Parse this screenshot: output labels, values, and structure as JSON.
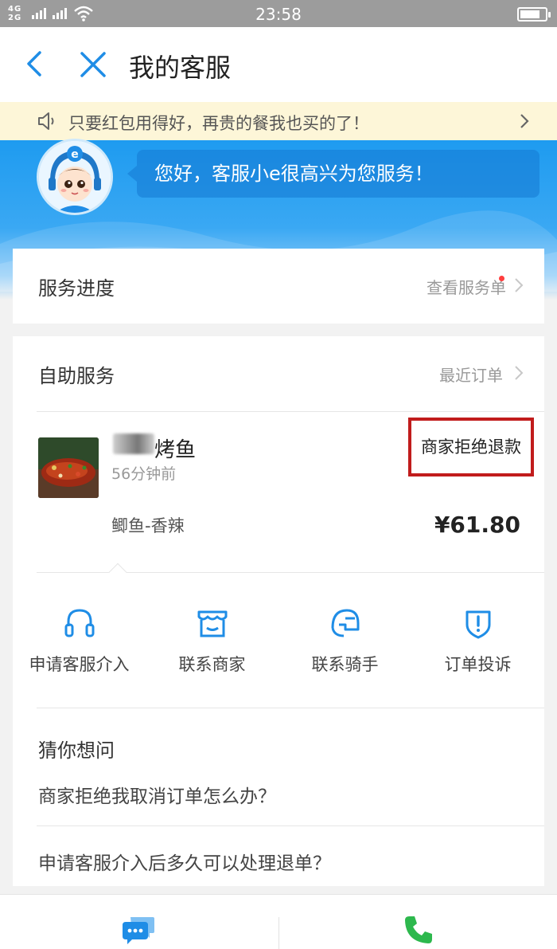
{
  "status_bar": {
    "network_top": "4G",
    "network_bottom": "2G",
    "network_mid": "2G",
    "time": "23:58"
  },
  "header": {
    "title": "我的客服"
  },
  "notice": {
    "text": "只要红包用得好，再贵的餐我也买的了！"
  },
  "greeting": {
    "text": "您好，客服小e很高兴为您服务！"
  },
  "service_progress": {
    "label": "服务进度",
    "link": "查看服务单"
  },
  "self_service": {
    "label": "自助服务",
    "link": "最近订单",
    "order": {
      "name": "烤鱼",
      "time": "56分钟前",
      "status": "商家拒绝退款",
      "item": "鲫鱼-香辣",
      "price": "¥61.80"
    },
    "actions": [
      {
        "label": "申请客服介入",
        "icon": "headset-icon"
      },
      {
        "label": "联系商家",
        "icon": "store-icon"
      },
      {
        "label": "联系骑手",
        "icon": "rider-helmet-icon"
      },
      {
        "label": "订单投诉",
        "icon": "complaint-shield-icon"
      }
    ]
  },
  "faq": {
    "title": "猜你想问",
    "questions": [
      "商家拒绝我取消订单怎么办？",
      "申请客服介入后多久可以处理退单？"
    ]
  },
  "colors": {
    "accent": "#1f8de6",
    "status_highlight": "#c11c1c",
    "phone": "#2db84d"
  }
}
